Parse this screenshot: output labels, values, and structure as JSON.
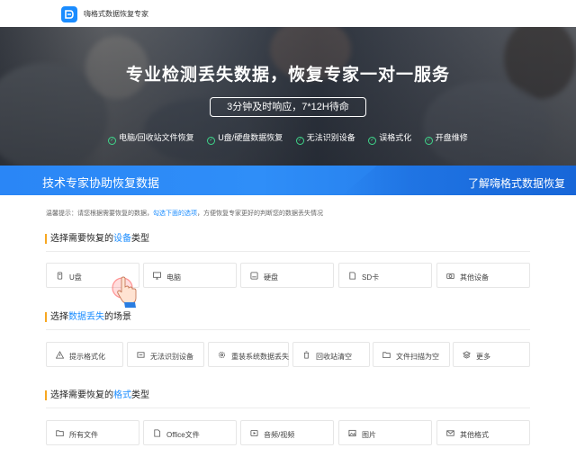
{
  "header": {
    "brand": "嗨格式数据恢复专家",
    "logo_icon": "brand-logo-icon"
  },
  "hero": {
    "title": "专业检测丢失数据，恢复专家一对一服务",
    "pill": "3分钟及时响应，7*12H待命",
    "features": [
      "电脑/回收站文件恢复",
      "U盘/硬盘数据恢复",
      "无法识别设备",
      "误格式化",
      "开盘维修"
    ]
  },
  "strip": {
    "title": "技术专家协助恢复数据",
    "link": "了解嗨格式数据恢复"
  },
  "tip": {
    "prefix": "温馨提示：请您根据需要恢复的数据，",
    "highlight": "勾选下面的选项",
    "suffix": "，方便恢复专家更好的判断您的数据丢失情况"
  },
  "sections": {
    "device": {
      "pre": "选择需要恢复的",
      "hl": "设备",
      "post": "类型",
      "items": [
        {
          "label": "U盘",
          "icon": "usb-drive-icon"
        },
        {
          "label": "电脑",
          "icon": "monitor-icon"
        },
        {
          "label": "硬盘",
          "icon": "hard-disk-icon"
        },
        {
          "label": "SD卡",
          "icon": "sd-card-icon"
        },
        {
          "label": "其他设备",
          "icon": "camera-icon"
        }
      ]
    },
    "scene": {
      "pre": "选择",
      "hl": "数据丢失",
      "post": "的场景",
      "items": [
        {
          "label": "提示格式化",
          "icon": "warning-icon"
        },
        {
          "label": "无法识别设备",
          "icon": "device-unrecognized-icon"
        },
        {
          "label": "重装系统数据丢失",
          "icon": "gear-icon"
        },
        {
          "label": "回收站清空",
          "icon": "trash-icon"
        },
        {
          "label": "文件扫描为空",
          "icon": "folder-icon"
        },
        {
          "label": "更多",
          "icon": "layers-icon"
        }
      ]
    },
    "format": {
      "pre": "选择需要恢复的",
      "hl": "格式",
      "post": "类型",
      "items": [
        {
          "label": "所有文件",
          "icon": "folder-icon"
        },
        {
          "label": "Office文件",
          "icon": "office-file-icon"
        },
        {
          "label": "音频/视频",
          "icon": "media-icon"
        },
        {
          "label": "图片",
          "icon": "image-icon"
        },
        {
          "label": "其他格式",
          "icon": "mail-icon"
        }
      ]
    }
  },
  "colors": {
    "accent": "#1a8cff",
    "heading_bar": "#f7a721",
    "check": "#3fd68a"
  }
}
